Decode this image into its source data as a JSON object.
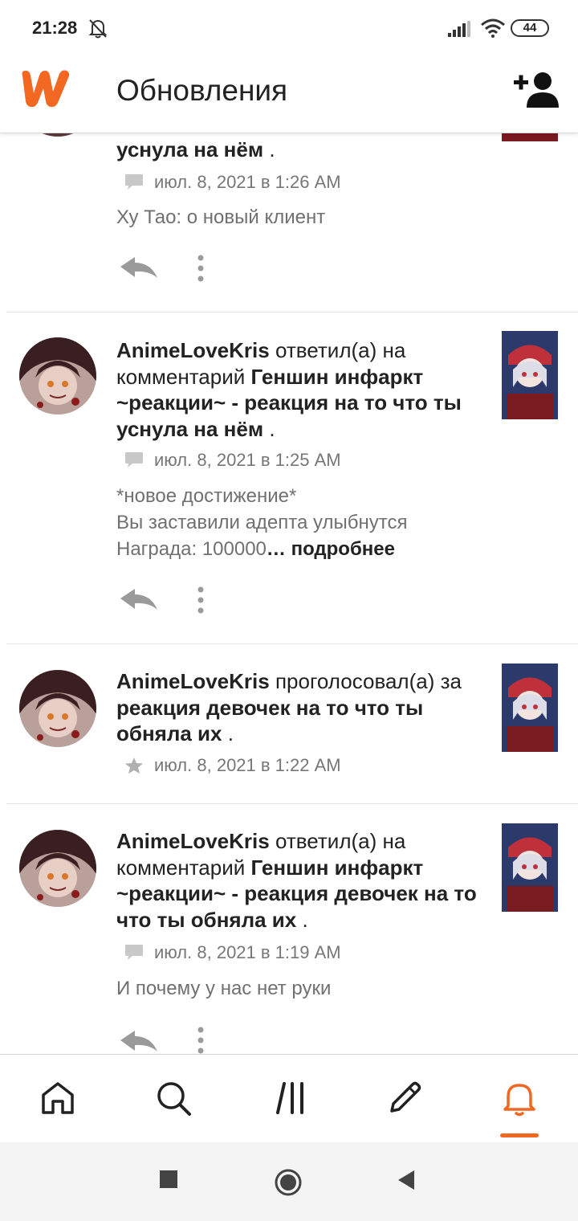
{
  "status_bar": {
    "time": "21:28",
    "battery": "44",
    "icons": [
      "bell-off-icon",
      "signal-icon",
      "wifi-icon",
      "battery-icon"
    ]
  },
  "header": {
    "logo": "wattpad-logo",
    "title": "Обновления",
    "add_user_icon": "add-user-icon"
  },
  "colors": {
    "accent": "#f26722",
    "text_primary": "#222222",
    "text_secondary": "#707070",
    "meta_gray": "#777777"
  },
  "feed": {
    "items": [
      {
        "headline_tail": "уснула на нём",
        "period": " .",
        "meta_icon": "comment-icon",
        "timestamp": "июл. 8, 2021 в 1:26 AM",
        "body": "Ху Тао: о новый клиент"
      },
      {
        "user": "AnimeLoveKris",
        "action": "ответил(а) на комментарий",
        "target": "Геншин инфаркт ~реакции~ - реакция на то что ты уснула на нём",
        "period": " .",
        "meta_icon": "comment-icon",
        "timestamp": "июл. 8, 2021 в 1:25 AM",
        "body": "*новое достижение*\nВы заставили адепта улыбнутся\nНаграда: 100000",
        "ellipsis": "…",
        "more": " подробнее"
      },
      {
        "user": "AnimeLoveKris",
        "action": "проголосовал(а) за",
        "target": "реакция девочек на то что ты обняла их",
        "period": " .",
        "meta_icon": "star-icon",
        "timestamp": "июл. 8, 2021 в 1:22 AM"
      },
      {
        "user": "AnimeLoveKris",
        "action": "ответил(а) на комментарий",
        "target": "Геншин инфаркт ~реакции~ - реакция девочек на то что ты обняла их",
        "period": " .",
        "meta_icon": "comment-icon",
        "timestamp": "июл. 8, 2021 в 1:19 AM",
        "body": "И почему у нас нет руки"
      }
    ]
  },
  "bottom_nav": {
    "items": [
      "home-icon",
      "search-icon",
      "library-icon",
      "write-icon",
      "notifications-icon"
    ],
    "active": "notifications-icon"
  },
  "system_nav": [
    "recents-button",
    "home-button",
    "back-button"
  ]
}
